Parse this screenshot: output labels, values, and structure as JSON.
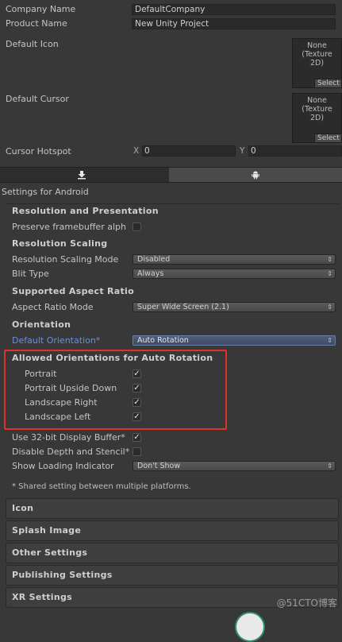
{
  "player": {
    "company_name_label": "Company Name",
    "company_name_value": "DefaultCompany",
    "product_name_label": "Product Name",
    "product_name_value": "New Unity Project",
    "default_icon_label": "Default Icon",
    "default_icon_text": "None\n(Texture\n2D)",
    "default_icon_select": "Select",
    "default_cursor_label": "Default Cursor",
    "default_cursor_text": "None\n(Texture\n2D)",
    "default_cursor_select": "Select",
    "cursor_hotspot_label": "Cursor Hotspot",
    "hotspot_x_label": "X",
    "hotspot_x_value": "0",
    "hotspot_y_label": "Y",
    "hotspot_y_value": "0"
  },
  "tabs": [
    {
      "icon": "download-icon",
      "active": false
    },
    {
      "icon": "android-icon",
      "active": true
    }
  ],
  "settings_header": "Settings for Android",
  "resolution": {
    "title": "Resolution and Presentation",
    "preserve_label": "Preserve framebuffer alph",
    "scaling_title": "Resolution Scaling",
    "scaling_mode_label": "Resolution Scaling Mode",
    "scaling_mode_value": "Disabled",
    "blit_label": "Blit Type",
    "blit_value": "Always",
    "aspect_title": "Supported Aspect Ratio",
    "aspect_mode_label": "Aspect Ratio Mode",
    "aspect_mode_value": "Super Wide Screen (2.1)",
    "orientation_title": "Orientation",
    "default_orientation_label": "Default Orientation*",
    "default_orientation_value": "Auto Rotation",
    "allowed_title": "Allowed Orientations for Auto Rotation",
    "portrait_label": "Portrait",
    "portrait_upside_label": "Portrait Upside Down",
    "landscape_right_label": "Landscape Right",
    "landscape_left_label": "Landscape Left",
    "display_buffer_label": "Use 32-bit Display Buffer*",
    "disable_depth_label": "Disable Depth and Stencil*",
    "loading_indicator_label": "Show Loading Indicator",
    "loading_indicator_value": "Don't Show",
    "shared_note": "* Shared setting between multiple platforms.",
    "check_mark": "✓",
    "dropdown_arrow": "⇕"
  },
  "foldouts": [
    "Icon",
    "Splash Image",
    "Other Settings",
    "Publishing Settings",
    "XR Settings"
  ],
  "watermark": "@51CTO博客",
  "accent_red": "#e0312b",
  "link_blue": "#6b8fd6"
}
